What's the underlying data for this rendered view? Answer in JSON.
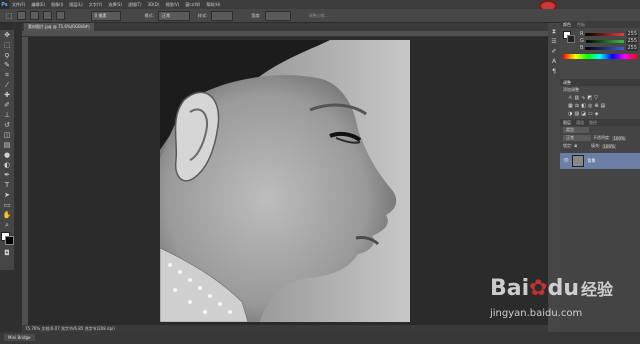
{
  "app": {
    "logo": "Ps"
  },
  "menu": [
    "文件(F)",
    "编辑(E)",
    "图像(I)",
    "图层(L)",
    "文字(Y)",
    "选择(S)",
    "滤镜(T)",
    "3D(D)",
    "视图(V)",
    "窗口(W)",
    "帮助(H)"
  ],
  "options": {
    "size_value": "0 像素",
    "mode_label": "模式:",
    "mode_value": "正常",
    "style_label": "样式:",
    "width_label": "宽度:",
    "refine_edge": "调整边缘..."
  },
  "document_tab": "素材图片.jpg @ 75.6%(RGB/8#)",
  "status": "75.76%    文档:6.07 兆字节/6.85 兆字节(208 dpi)",
  "bottom_tab": "Mini Bridge",
  "workspace": "基本功能",
  "panels": {
    "color_tab": "颜色",
    "swatch_tab": "色板",
    "channels": [
      {
        "label": "R",
        "value": "255",
        "color": "#e04040"
      },
      {
        "label": "G",
        "value": "255",
        "color": "#40c040"
      },
      {
        "label": "B",
        "value": "255",
        "color": "#4060e0"
      }
    ],
    "adjust_tab": "调整",
    "adjust_title": "添加调整",
    "layers_tab": "图层",
    "channels_tab": "通道",
    "paths_tab": "路径",
    "layer_kind": "类型",
    "blend": "正常",
    "opacity_label": "不透明度:",
    "opacity": "100%",
    "lock_label": "锁定:",
    "fill_label": "填充:",
    "fill": "100%",
    "layer_name": "背景"
  },
  "watermark": {
    "brand": "Bai",
    "paw": "du",
    "product": "经验",
    "url": "jingyan.baidu.com"
  },
  "colors": {
    "accent": "#2f6fd6",
    "record": "#c93a3a"
  }
}
